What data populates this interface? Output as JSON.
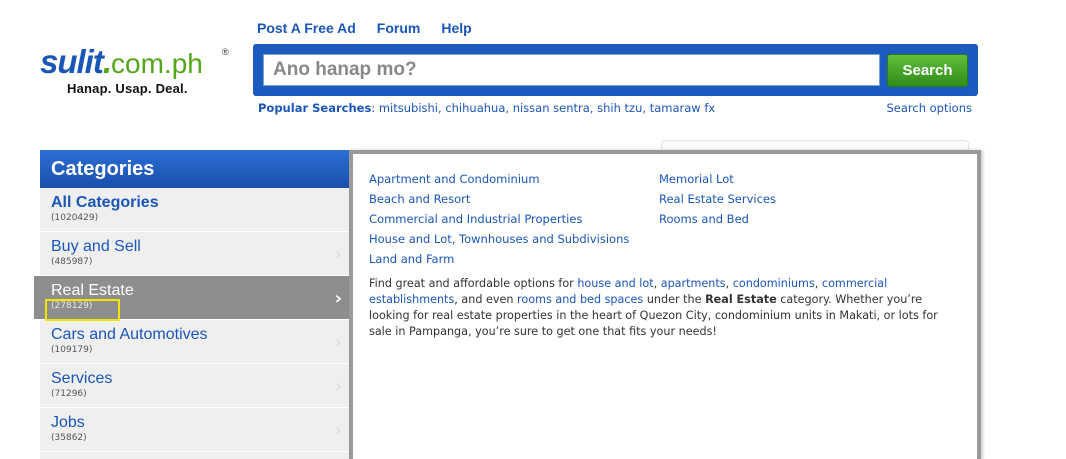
{
  "logo": {
    "brand": "sulit",
    "dot": ".",
    "tld": "com.ph",
    "reg": "®",
    "tagline": "Hanap. Usap. Deal."
  },
  "nav": [
    "Post A Free Ad",
    "Forum",
    "Help"
  ],
  "search": {
    "placeholder": "Ano hanap mo?",
    "button": "Search"
  },
  "popular": {
    "label": "Popular Searches",
    "sep": ":",
    "items": [
      "mitsubishi",
      "chihuahua",
      "nissan sentra",
      "shih tzu",
      "tamaraw fx"
    ],
    "options": "Search options"
  },
  "categories": {
    "title": "Categories",
    "items": [
      {
        "name": "All Categories",
        "count": "(1020429)"
      },
      {
        "name": "Buy and Sell",
        "count": "(485987)"
      },
      {
        "name": "Real Estate",
        "count": "(278129)"
      },
      {
        "name": "Cars and Automotives",
        "count": "(109179)"
      },
      {
        "name": "Services",
        "count": "(71296)"
      },
      {
        "name": "Jobs",
        "count": "(35862)"
      }
    ],
    "chevron": "›"
  },
  "subcategories": {
    "col1": [
      "Apartment and Condominium",
      "Beach and Resort",
      "Commercial and Industrial Properties",
      "House and Lot, Townhouses and Subdivisions",
      "Land and Farm"
    ],
    "col2": [
      "Memorial Lot",
      "Real Estate Services",
      "Rooms and Bed"
    ]
  },
  "description": {
    "t1": "Find great and affordable options for ",
    "l1": "house and lot",
    "t2": ", ",
    "l2": "apartments",
    "t3": ", ",
    "l3": "condominiums",
    "t4": ", ",
    "l4": "commercial establishments",
    "t5": ", and even ",
    "l5": "rooms and bed spaces",
    "t6": " under the ",
    "b1": "Real Estate",
    "t7": " category. Whether you’re looking for real estate properties in the heart of Quezon City, condominium units in Makati, or lots for sale in Pampanga, you’re sure to get one that fits your needs!"
  }
}
